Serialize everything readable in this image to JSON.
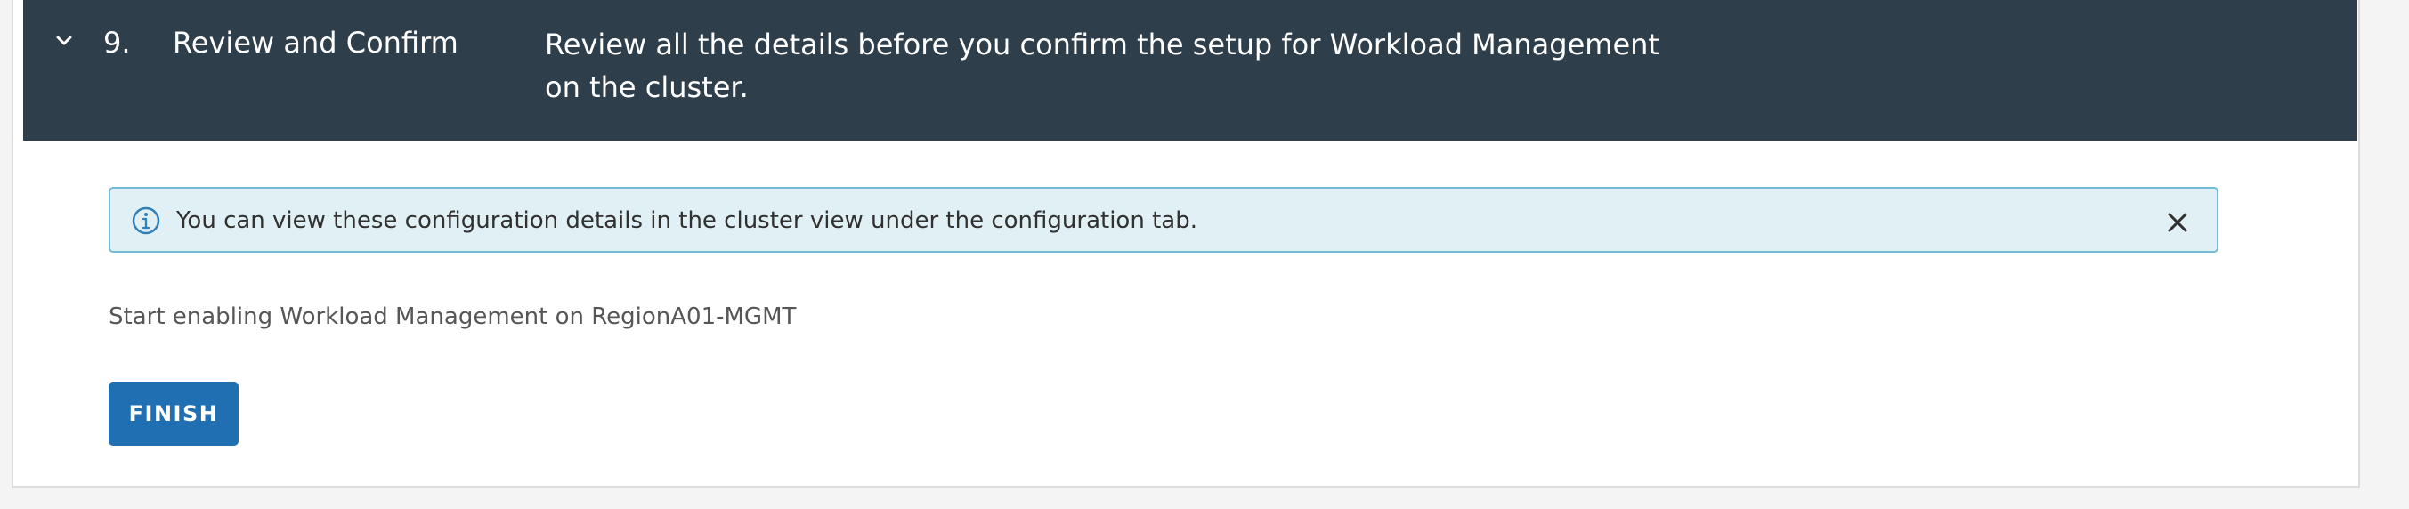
{
  "step": {
    "number": "9.",
    "title": "Review and Confirm",
    "description": "Review all the details before you confirm the setup for Workload Management on the cluster.",
    "chevron_icon": "chevron-down-icon",
    "expanded": true
  },
  "alert": {
    "icon": "info-icon",
    "text": "You can view these configuration details in the cluster view under the configuration tab.",
    "close_icon": "close-icon"
  },
  "summary": {
    "text": "Start enabling Workload Management on RegionA01-MGMT"
  },
  "actions": {
    "finish_label": "FINISH"
  },
  "colors": {
    "header_background": "#2f3e4b",
    "alert_background": "#e1f0f5",
    "alert_border": "#74b9d6",
    "primary_button": "#1f6fb2"
  }
}
